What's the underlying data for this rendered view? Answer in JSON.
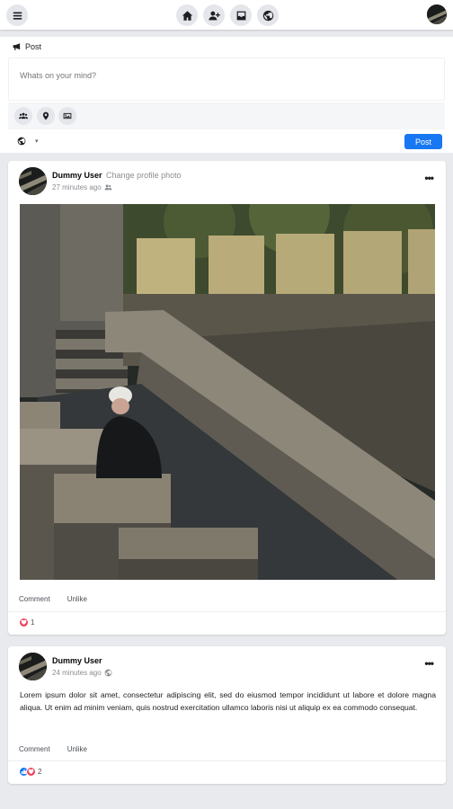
{
  "header": {
    "icons": [
      "menu-icon",
      "home-icon",
      "add-friend-icon",
      "inbox-icon",
      "globe-icon"
    ]
  },
  "composer": {
    "title": "Post",
    "placeholder": "Whats on your mind?",
    "tools": [
      "group-icon",
      "location-icon",
      "photo-icon"
    ],
    "privacy_icon": "globe-icon",
    "submit_label": "Post"
  },
  "posts": [
    {
      "author": "Dummy User",
      "action": "Change profile photo",
      "time": "27 minutes ago",
      "privacy_icon": "friends-icon",
      "comment_label": "Comment",
      "unlike_label": "Unlike",
      "reaction_count": "1",
      "reactions": [
        "heart"
      ]
    },
    {
      "author": "Dummy User",
      "time": "24 minutes ago",
      "privacy_icon": "globe-icon",
      "body": "Lorem ipsum dolor sit amet, consectetur adipiscing elit, sed do eiusmod tempor incididunt ut labore et dolore magna aliqua. Ut enim ad minim veniam, quis nostrud exercitation ullamco laboris nisi ut aliquip ex ea commodo consequat.",
      "comment_label": "Comment",
      "unlike_label": "Unlike",
      "reaction_count": "2",
      "reactions": [
        "like",
        "heart"
      ]
    }
  ],
  "colors": {
    "accent": "#1877f2",
    "heart": "#f33e58",
    "background": "#e9eaed"
  }
}
